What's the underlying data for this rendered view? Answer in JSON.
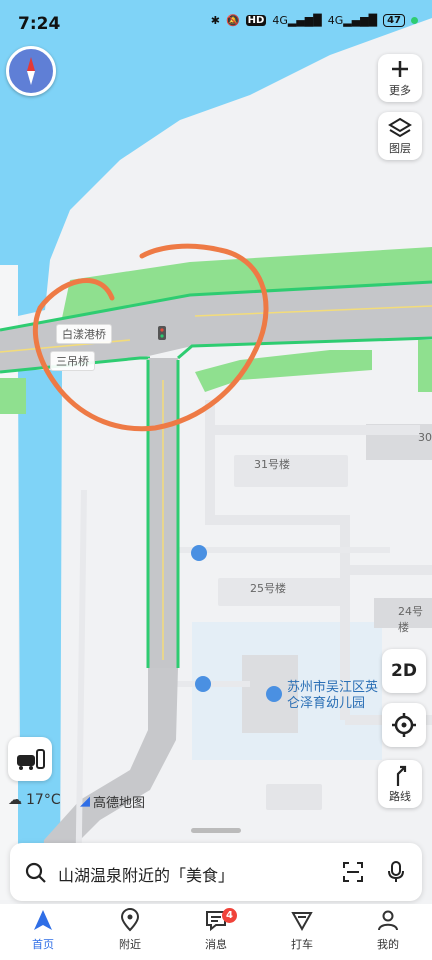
{
  "status_bar": {
    "time": "7:24",
    "hd": "HD",
    "net1": "4G",
    "net2": "4G",
    "battery": "47"
  },
  "controls": {
    "more_label": "更多",
    "layers_label": "图层",
    "mode_2d": "2D",
    "route_label": "路线"
  },
  "map": {
    "road_labels": [
      "白漾港桥",
      "三吊桥"
    ],
    "buildings": [
      "31号楼",
      "25号楼",
      "24号楼",
      "30"
    ],
    "poi": {
      "line1": "苏州市吴江区英",
      "line2": "仑泽育幼儿园"
    }
  },
  "weather": {
    "temp": "17°C",
    "icon": "cloudy-icon"
  },
  "brand": "高德地图",
  "search": {
    "text": "山湖温泉附近的「美食」"
  },
  "tabs": [
    {
      "label": "首页",
      "icon": "navigation-arrow-icon",
      "active": true
    },
    {
      "label": "附近",
      "icon": "location-pin-icon"
    },
    {
      "label": "消息",
      "icon": "message-icon",
      "badge": "4"
    },
    {
      "label": "打车",
      "icon": "taxi-icon"
    },
    {
      "label": "我的",
      "icon": "user-icon"
    }
  ],
  "colors": {
    "water": "#7fd3f7",
    "green": "#8fe08f",
    "road": "#c8c8c8",
    "accent": "#2f6ee6",
    "annotation": "#ee7a45"
  }
}
